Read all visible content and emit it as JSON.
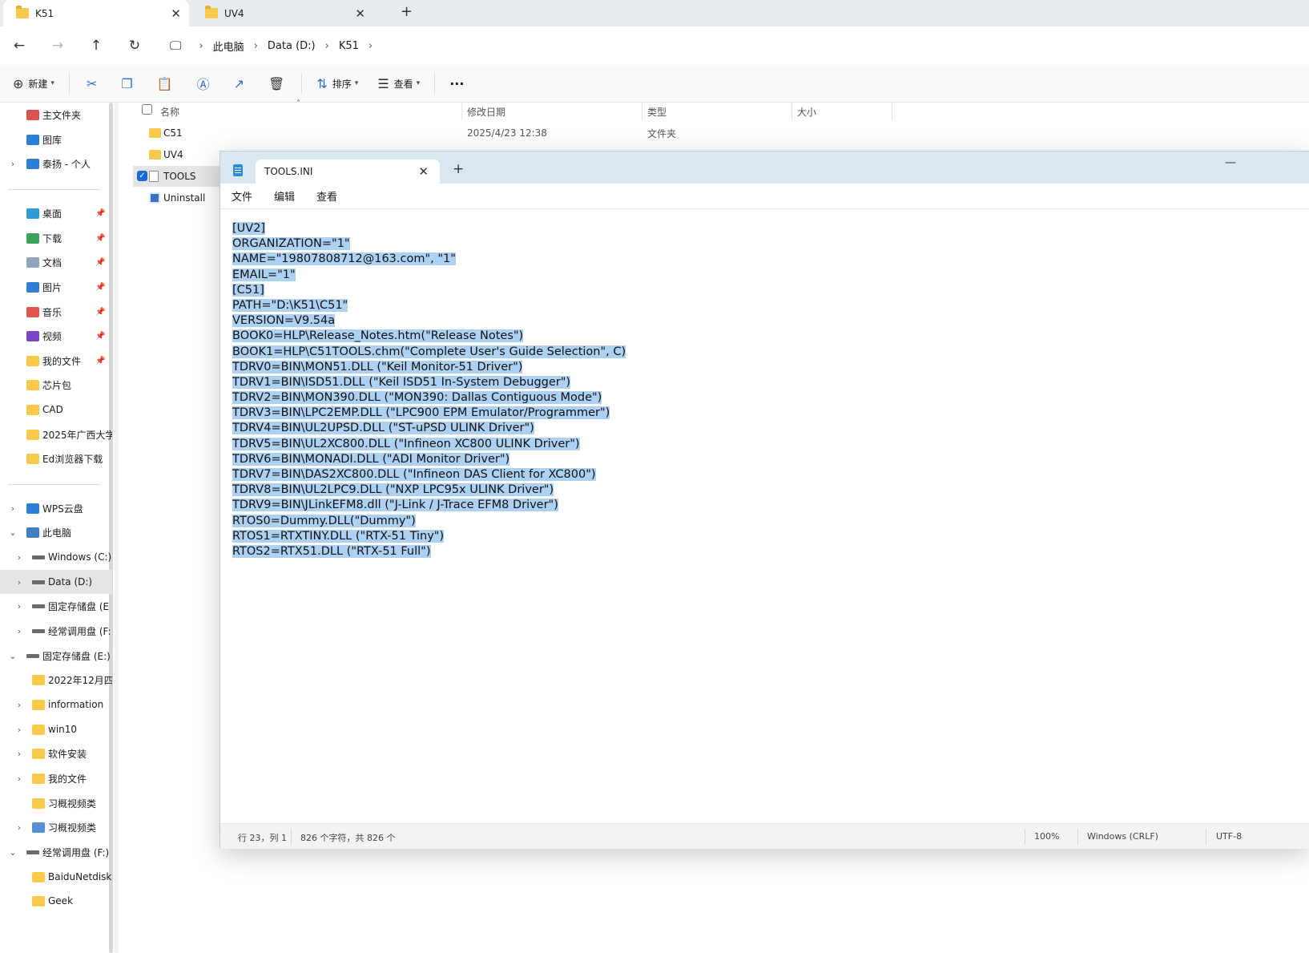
{
  "explorer": {
    "tabs": [
      {
        "label": "K51",
        "active": true
      },
      {
        "label": "UV4",
        "active": false
      }
    ],
    "breadcrumb": [
      "此电脑",
      "Data (D:)",
      "K51"
    ],
    "commands": {
      "new": "新建",
      "sort": "排序",
      "view": "查看",
      "more": "···"
    },
    "columns": {
      "name": "名称",
      "date": "修改日期",
      "type": "类型",
      "size": "大小"
    },
    "files": [
      {
        "name": "C51",
        "date": "2025/4/23 12:38",
        "type": "文件夹"
      },
      {
        "name": "UV4",
        "date": "",
        "type": ""
      },
      {
        "name": "TOOLS",
        "date": "",
        "type": ""
      },
      {
        "name": "Uninstall",
        "date": "",
        "type": ""
      }
    ],
    "sidebar": [
      {
        "label": "主文件夹",
        "icon": "home-icon"
      },
      {
        "label": "图库",
        "icon": "gallery-icon"
      },
      {
        "label": "泰扬 - 个人",
        "icon": "cloud-icon"
      },
      {
        "label": "桌面",
        "icon": "desktop-icon"
      },
      {
        "label": "下载",
        "icon": "download-icon"
      },
      {
        "label": "文档",
        "icon": "document-icon"
      },
      {
        "label": "图片",
        "icon": "picture-icon"
      },
      {
        "label": "音乐",
        "icon": "music-icon"
      },
      {
        "label": "视频",
        "icon": "video-icon"
      },
      {
        "label": "我的文件",
        "icon": "folder-icon"
      },
      {
        "label": "芯片包",
        "icon": "folder-icon"
      },
      {
        "label": "CAD",
        "icon": "folder-icon"
      },
      {
        "label": "2025年广西大学",
        "icon": "folder-icon"
      },
      {
        "label": "Ed浏览器下载",
        "icon": "folder-icon"
      },
      {
        "label": "WPS云盘",
        "icon": "cloud-icon"
      },
      {
        "label": "此电脑",
        "icon": "computer-icon"
      },
      {
        "label": "Windows (C:)",
        "icon": "drive-icon"
      },
      {
        "label": "Data (D:)",
        "icon": "drive-icon"
      },
      {
        "label": "固定存储盘 (E",
        "icon": "drive-icon"
      },
      {
        "label": "经常调用盘 (F:",
        "icon": "drive-icon"
      },
      {
        "label": "固定存储盘 (E:)",
        "icon": "drive-icon"
      },
      {
        "label": "2022年12月四",
        "icon": "folder-icon"
      },
      {
        "label": "information",
        "icon": "folder-icon"
      },
      {
        "label": "win10",
        "icon": "folder-icon"
      },
      {
        "label": "软件安装",
        "icon": "folder-icon"
      },
      {
        "label": "我的文件",
        "icon": "folder-icon"
      },
      {
        "label": "习概视频类",
        "icon": "folder-icon"
      },
      {
        "label": "习概视频类",
        "icon": "folder-icon"
      },
      {
        "label": "经常调用盘 (F:)",
        "icon": "drive-icon"
      },
      {
        "label": "BaiduNetdisk",
        "icon": "folder-icon"
      },
      {
        "label": "Geek",
        "icon": "folder-icon"
      }
    ]
  },
  "notepad": {
    "tab_title": "TOOLS.INI",
    "menu": [
      "文件",
      "编辑",
      "查看"
    ],
    "lines": [
      "[UV2]",
      "ORGANIZATION=\"1\"",
      "NAME=\"19807808712@163.com\", \"1\"",
      "EMAIL=\"1\"",
      "[C51]",
      "PATH=\"D:\\K51\\C51\"",
      "VERSION=V9.54a",
      "BOOK0=HLP\\Release_Notes.htm(\"Release Notes\")",
      "BOOK1=HLP\\C51TOOLS.chm(\"Complete User's Guide Selection\", C)",
      "TDRV0=BIN\\MON51.DLL (\"Keil Monitor-51 Driver\")",
      "TDRV1=BIN\\ISD51.DLL (\"Keil ISD51 In-System Debugger\")",
      "TDRV2=BIN\\MON390.DLL (\"MON390: Dallas Contiguous Mode\")",
      "TDRV3=BIN\\LPC2EMP.DLL (\"LPC900 EPM Emulator/Programmer\")",
      "TDRV4=BIN\\UL2UPSD.DLL (\"ST-uPSD ULINK Driver\")",
      "TDRV5=BIN\\UL2XC800.DLL (\"Infineon XC800 ULINK Driver\")",
      "TDRV6=BIN\\MONADI.DLL (\"ADI Monitor Driver\")",
      "TDRV7=BIN\\DAS2XC800.DLL (\"Infineon DAS Client for XC800\")",
      "TDRV8=BIN\\UL2LPC9.DLL (\"NXP LPC95x ULINK Driver\")",
      "TDRV9=BIN\\JLinkEFM8.dll (\"J-Link / J-Trace EFM8 Driver\")",
      "RTOS0=Dummy.DLL(\"Dummy\")",
      "RTOS1=RTXTINY.DLL (\"RTX-51 Tiny\")",
      "RTOS2=RTX51.DLL (\"RTX-51 Full\")"
    ],
    "status": {
      "position": "行 23，列 1",
      "chars": "826 个字符，共 826 个",
      "zoom": "100%",
      "line_ending": "Windows (CRLF)",
      "encoding": "UTF-8"
    }
  }
}
